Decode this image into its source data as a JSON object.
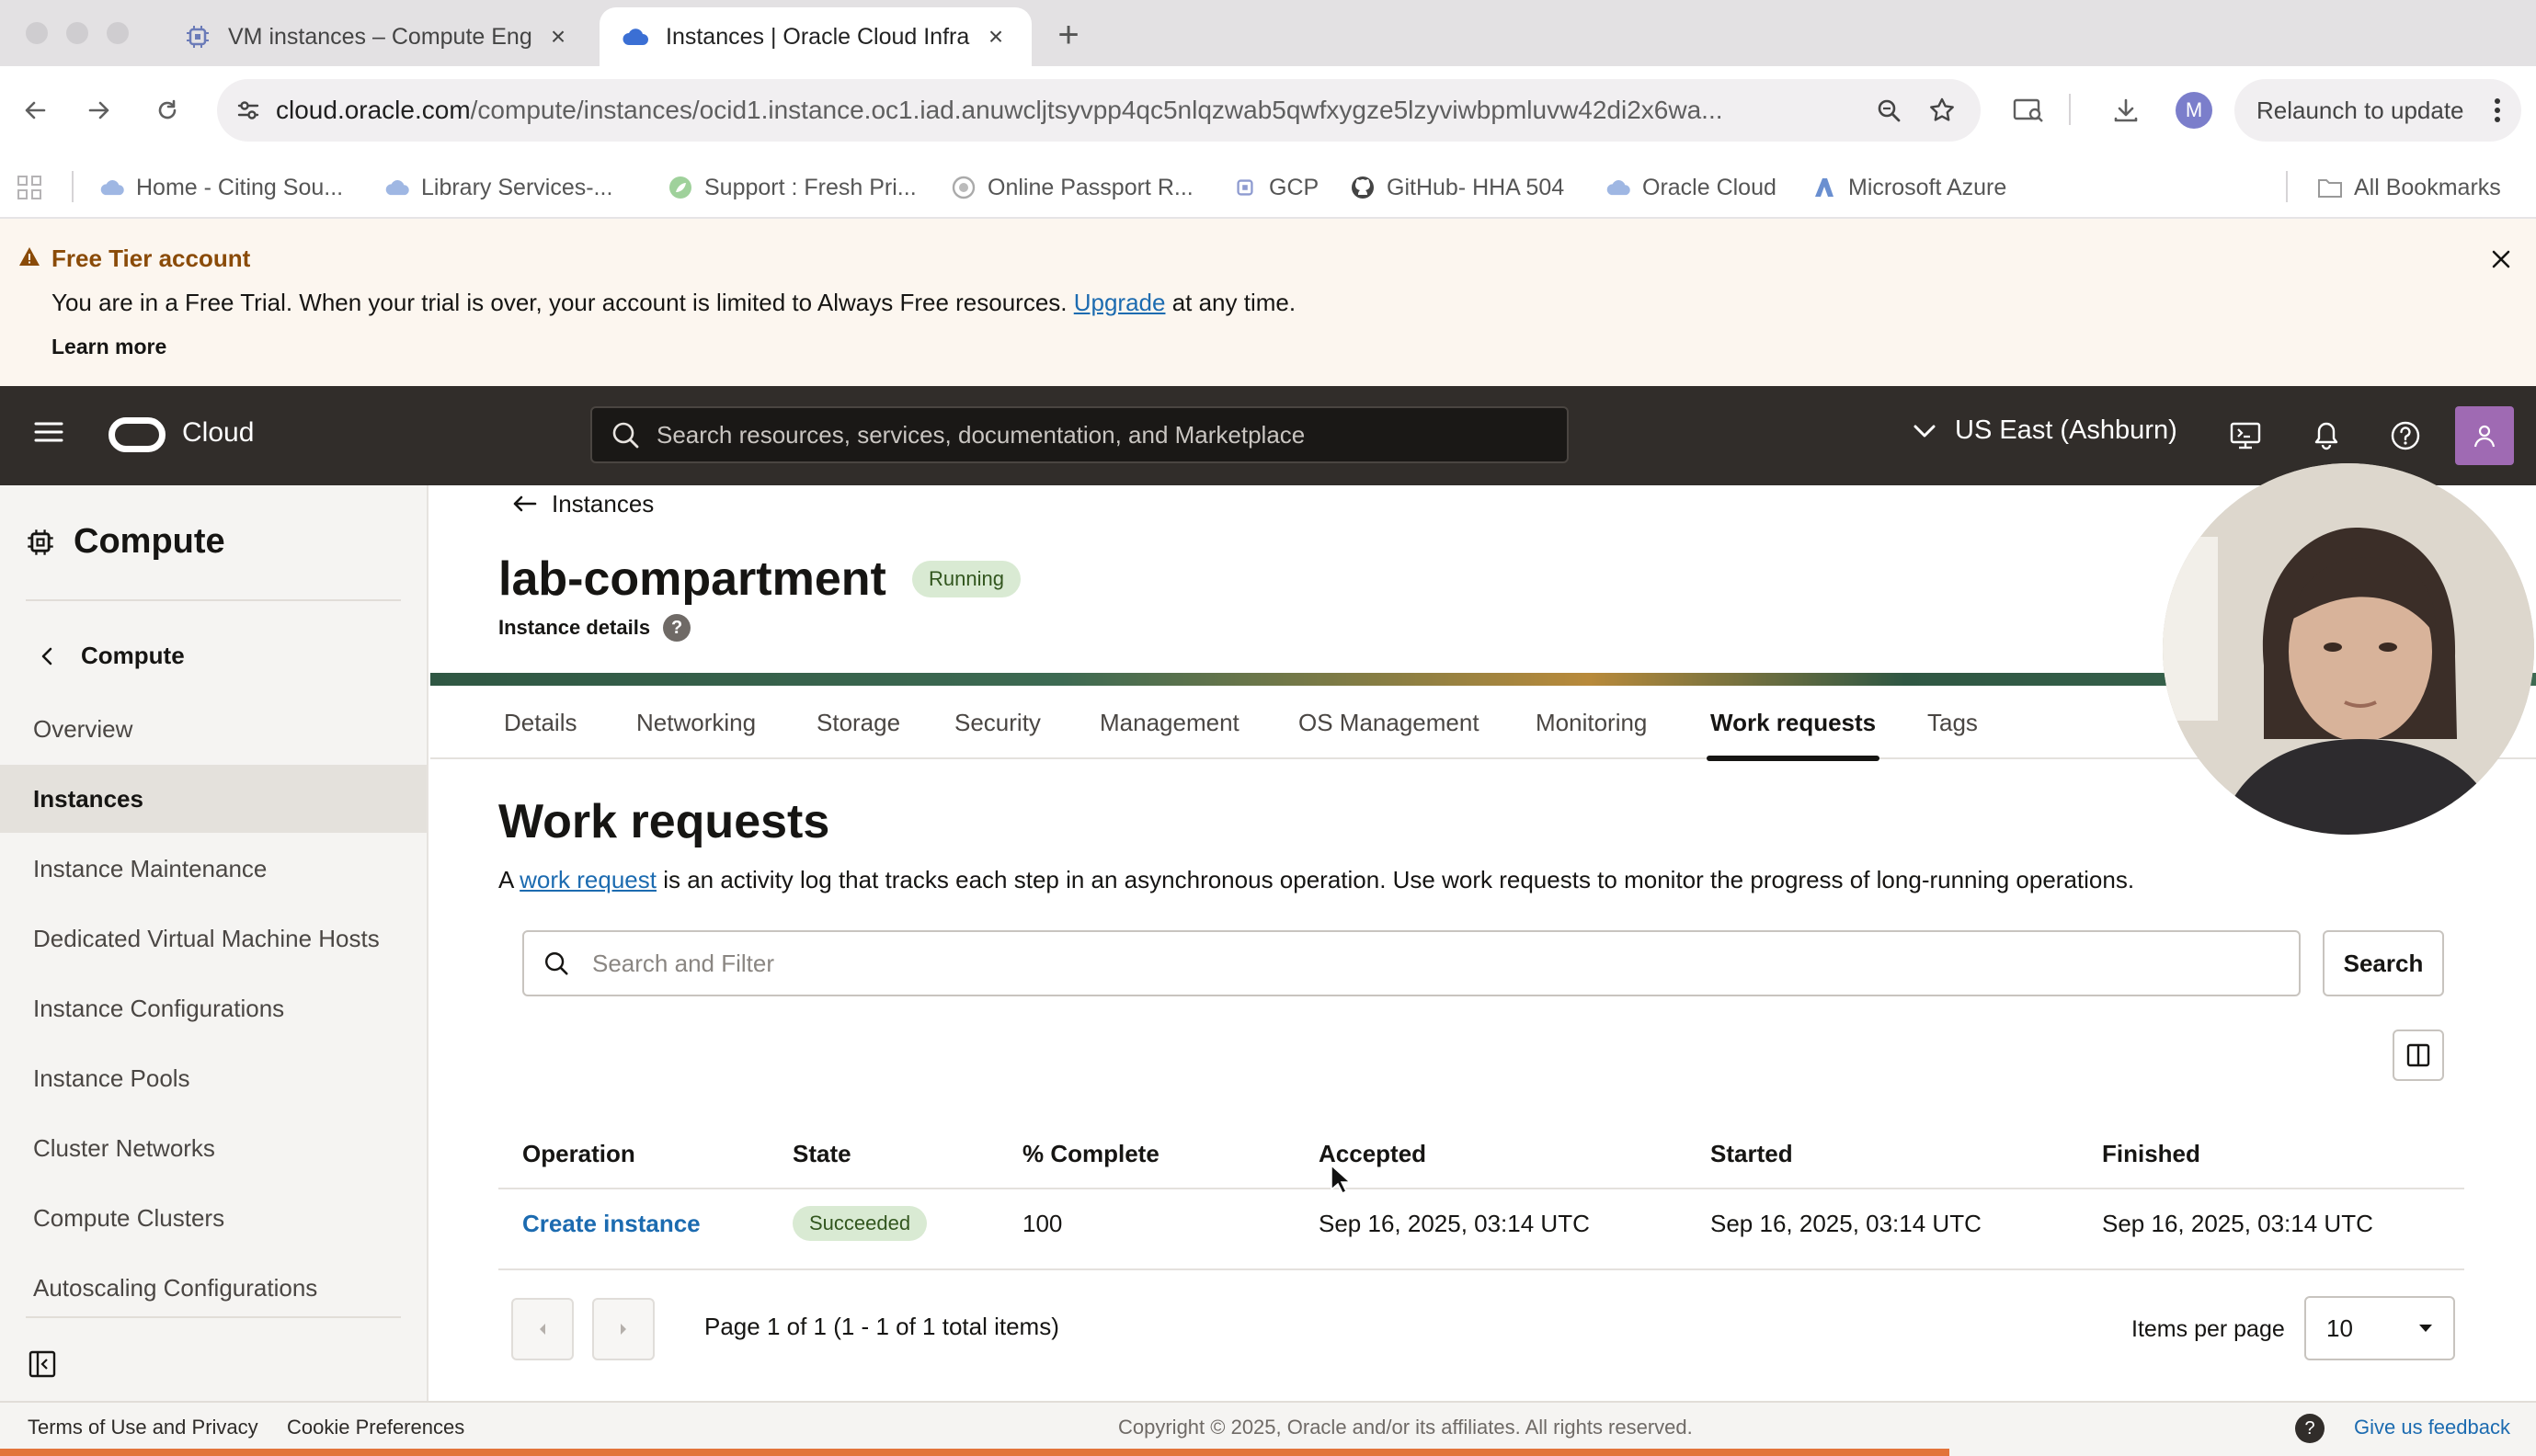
{
  "browser": {
    "tabs": [
      {
        "title": "VM instances – Compute Eng",
        "icon": "gcp-compute-icon",
        "active": false
      },
      {
        "title": "Instances | Oracle Cloud Infra",
        "icon": "oracle-cloud-icon",
        "active": true
      }
    ],
    "new_tab": "+",
    "url_host": "cloud.oracle.com",
    "url_path": "/compute/instances/ocid1.instance.oc1.iad.anuwcljtsyvpp4qc5nlqzwab5qwfxygze5lzyviwbpmluvw42di2x6wa...",
    "profile_initial": "M",
    "relaunch_label": "Relaunch to update",
    "bookmarks": [
      {
        "label": "Home - Citing Sou...",
        "icon": "cloud-icon"
      },
      {
        "label": "Library Services-...",
        "icon": "cloud-icon"
      },
      {
        "label": "Support : Fresh Pri...",
        "icon": "leaf-icon"
      },
      {
        "label": "Online Passport R...",
        "icon": "seal-icon"
      },
      {
        "label": "GCP",
        "icon": "chip-icon"
      },
      {
        "label": "GitHub- HHA 504",
        "icon": "github-icon"
      },
      {
        "label": "Oracle Cloud",
        "icon": "cloud-icon"
      },
      {
        "label": "Microsoft Azure",
        "icon": "azure-icon"
      }
    ],
    "all_bookmarks": "All Bookmarks"
  },
  "banner": {
    "title": "Free Tier account",
    "text_before": "You are in a Free Trial. When your trial is over, your account is limited to Always Free resources. ",
    "link": "Upgrade",
    "text_after": " at any time.",
    "learn_more": "Learn more"
  },
  "header": {
    "brand": "Cloud",
    "search_placeholder": "Search resources, services, documentation, and Marketplace",
    "region": "US East (Ashburn)"
  },
  "sidebar": {
    "title": "Compute",
    "back_label": "Compute",
    "items": [
      {
        "label": "Overview",
        "active": false
      },
      {
        "label": "Instances",
        "active": true
      },
      {
        "label": "Instance Maintenance",
        "active": false
      },
      {
        "label": "Dedicated Virtual Machine Hosts",
        "active": false
      },
      {
        "label": "Instance Configurations",
        "active": false
      },
      {
        "label": "Instance Pools",
        "active": false
      },
      {
        "label": "Cluster Networks",
        "active": false
      },
      {
        "label": "Compute Clusters",
        "active": false
      },
      {
        "label": "Autoscaling Configurations",
        "active": false
      }
    ]
  },
  "instance": {
    "breadcrumb": "Instances",
    "name": "lab-compartment",
    "status": "Running",
    "subtitle": "Instance details",
    "help": "?"
  },
  "tabs": [
    {
      "label": "Details",
      "active": false
    },
    {
      "label": "Networking",
      "active": false
    },
    {
      "label": "Storage",
      "active": false
    },
    {
      "label": "Security",
      "active": false
    },
    {
      "label": "Management",
      "active": false
    },
    {
      "label": "OS Management",
      "active": false
    },
    {
      "label": "Monitoring",
      "active": false
    },
    {
      "label": "Work requests",
      "active": true
    },
    {
      "label": "Tags",
      "active": false
    }
  ],
  "work_requests": {
    "title": "Work requests",
    "desc_before": "A ",
    "desc_link": "work request",
    "desc_after": " is an activity log that tracks each step in an asynchronous operation. Use work requests to monitor the progress of long-running operations.",
    "filter_placeholder": "Search and Filter",
    "search_button": "Search",
    "columns": [
      "Operation",
      "State",
      "% Complete",
      "Accepted",
      "Started",
      "Finished"
    ],
    "rows": [
      {
        "operation": "Create instance",
        "state": "Succeeded",
        "percent": "100",
        "accepted": "Sep 16, 2025, 03:14 UTC",
        "started": "Sep 16, 2025, 03:14 UTC",
        "finished": "Sep 16, 2025, 03:14 UTC"
      }
    ],
    "pagination_text": "Page 1 of 1 (1 - 1 of 1 total items)",
    "items_per_page_label": "Items per page",
    "items_per_page": "10"
  },
  "footer": {
    "terms": "Terms of Use and Privacy",
    "cookies": "Cookie Preferences",
    "copyright": "Copyright © 2025, Oracle and/or its affiliates. All rights reserved.",
    "help": "?",
    "feedback": "Give us feedback"
  },
  "colors": {
    "header_bg": "#312d2a",
    "link": "#1c6bb0",
    "success_badge": "#d9ead3",
    "banner_bg": "#fcf6ef"
  }
}
